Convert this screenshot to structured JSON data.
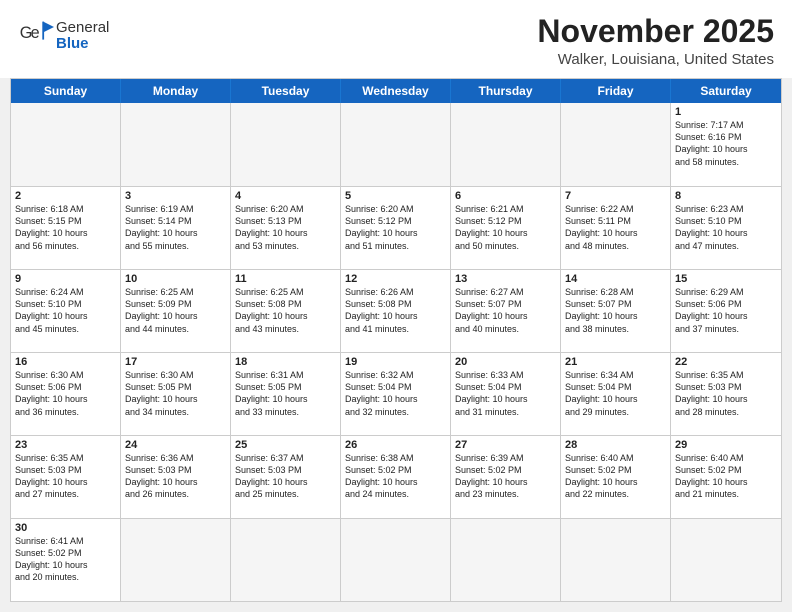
{
  "header": {
    "logo_general": "General",
    "logo_blue": "Blue",
    "month_title": "November 2025",
    "location": "Walker, Louisiana, United States"
  },
  "calendar": {
    "days_of_week": [
      "Sunday",
      "Monday",
      "Tuesday",
      "Wednesday",
      "Thursday",
      "Friday",
      "Saturday"
    ],
    "weeks": [
      [
        {
          "day": "",
          "info": "",
          "empty": true
        },
        {
          "day": "",
          "info": "",
          "empty": true
        },
        {
          "day": "",
          "info": "",
          "empty": true
        },
        {
          "day": "",
          "info": "",
          "empty": true
        },
        {
          "day": "",
          "info": "",
          "empty": true
        },
        {
          "day": "",
          "info": "",
          "empty": true
        },
        {
          "day": "1",
          "info": "Sunrise: 7:17 AM\nSunset: 6:16 PM\nDaylight: 10 hours\nand 58 minutes.",
          "empty": false
        }
      ],
      [
        {
          "day": "2",
          "info": "Sunrise: 6:18 AM\nSunset: 5:15 PM\nDaylight: 10 hours\nand 56 minutes.",
          "empty": false
        },
        {
          "day": "3",
          "info": "Sunrise: 6:19 AM\nSunset: 5:14 PM\nDaylight: 10 hours\nand 55 minutes.",
          "empty": false
        },
        {
          "day": "4",
          "info": "Sunrise: 6:20 AM\nSunset: 5:13 PM\nDaylight: 10 hours\nand 53 minutes.",
          "empty": false
        },
        {
          "day": "5",
          "info": "Sunrise: 6:20 AM\nSunset: 5:12 PM\nDaylight: 10 hours\nand 51 minutes.",
          "empty": false
        },
        {
          "day": "6",
          "info": "Sunrise: 6:21 AM\nSunset: 5:12 PM\nDaylight: 10 hours\nand 50 minutes.",
          "empty": false
        },
        {
          "day": "7",
          "info": "Sunrise: 6:22 AM\nSunset: 5:11 PM\nDaylight: 10 hours\nand 48 minutes.",
          "empty": false
        },
        {
          "day": "8",
          "info": "Sunrise: 6:23 AM\nSunset: 5:10 PM\nDaylight: 10 hours\nand 47 minutes.",
          "empty": false
        }
      ],
      [
        {
          "day": "9",
          "info": "Sunrise: 6:24 AM\nSunset: 5:10 PM\nDaylight: 10 hours\nand 45 minutes.",
          "empty": false
        },
        {
          "day": "10",
          "info": "Sunrise: 6:25 AM\nSunset: 5:09 PM\nDaylight: 10 hours\nand 44 minutes.",
          "empty": false
        },
        {
          "day": "11",
          "info": "Sunrise: 6:25 AM\nSunset: 5:08 PM\nDaylight: 10 hours\nand 43 minutes.",
          "empty": false
        },
        {
          "day": "12",
          "info": "Sunrise: 6:26 AM\nSunset: 5:08 PM\nDaylight: 10 hours\nand 41 minutes.",
          "empty": false
        },
        {
          "day": "13",
          "info": "Sunrise: 6:27 AM\nSunset: 5:07 PM\nDaylight: 10 hours\nand 40 minutes.",
          "empty": false
        },
        {
          "day": "14",
          "info": "Sunrise: 6:28 AM\nSunset: 5:07 PM\nDaylight: 10 hours\nand 38 minutes.",
          "empty": false
        },
        {
          "day": "15",
          "info": "Sunrise: 6:29 AM\nSunset: 5:06 PM\nDaylight: 10 hours\nand 37 minutes.",
          "empty": false
        }
      ],
      [
        {
          "day": "16",
          "info": "Sunrise: 6:30 AM\nSunset: 5:06 PM\nDaylight: 10 hours\nand 36 minutes.",
          "empty": false
        },
        {
          "day": "17",
          "info": "Sunrise: 6:30 AM\nSunset: 5:05 PM\nDaylight: 10 hours\nand 34 minutes.",
          "empty": false
        },
        {
          "day": "18",
          "info": "Sunrise: 6:31 AM\nSunset: 5:05 PM\nDaylight: 10 hours\nand 33 minutes.",
          "empty": false
        },
        {
          "day": "19",
          "info": "Sunrise: 6:32 AM\nSunset: 5:04 PM\nDaylight: 10 hours\nand 32 minutes.",
          "empty": false
        },
        {
          "day": "20",
          "info": "Sunrise: 6:33 AM\nSunset: 5:04 PM\nDaylight: 10 hours\nand 31 minutes.",
          "empty": false
        },
        {
          "day": "21",
          "info": "Sunrise: 6:34 AM\nSunset: 5:04 PM\nDaylight: 10 hours\nand 29 minutes.",
          "empty": false
        },
        {
          "day": "22",
          "info": "Sunrise: 6:35 AM\nSunset: 5:03 PM\nDaylight: 10 hours\nand 28 minutes.",
          "empty": false
        }
      ],
      [
        {
          "day": "23",
          "info": "Sunrise: 6:35 AM\nSunset: 5:03 PM\nDaylight: 10 hours\nand 27 minutes.",
          "empty": false
        },
        {
          "day": "24",
          "info": "Sunrise: 6:36 AM\nSunset: 5:03 PM\nDaylight: 10 hours\nand 26 minutes.",
          "empty": false
        },
        {
          "day": "25",
          "info": "Sunrise: 6:37 AM\nSunset: 5:03 PM\nDaylight: 10 hours\nand 25 minutes.",
          "empty": false
        },
        {
          "day": "26",
          "info": "Sunrise: 6:38 AM\nSunset: 5:02 PM\nDaylight: 10 hours\nand 24 minutes.",
          "empty": false
        },
        {
          "day": "27",
          "info": "Sunrise: 6:39 AM\nSunset: 5:02 PM\nDaylight: 10 hours\nand 23 minutes.",
          "empty": false
        },
        {
          "day": "28",
          "info": "Sunrise: 6:40 AM\nSunset: 5:02 PM\nDaylight: 10 hours\nand 22 minutes.",
          "empty": false
        },
        {
          "day": "29",
          "info": "Sunrise: 6:40 AM\nSunset: 5:02 PM\nDaylight: 10 hours\nand 21 minutes.",
          "empty": false
        }
      ],
      [
        {
          "day": "30",
          "info": "Sunrise: 6:41 AM\nSunset: 5:02 PM\nDaylight: 10 hours\nand 20 minutes.",
          "empty": false
        },
        {
          "day": "",
          "info": "",
          "empty": true
        },
        {
          "day": "",
          "info": "",
          "empty": true
        },
        {
          "day": "",
          "info": "",
          "empty": true
        },
        {
          "day": "",
          "info": "",
          "empty": true
        },
        {
          "day": "",
          "info": "",
          "empty": true
        },
        {
          "day": "",
          "info": "",
          "empty": true
        }
      ]
    ]
  }
}
